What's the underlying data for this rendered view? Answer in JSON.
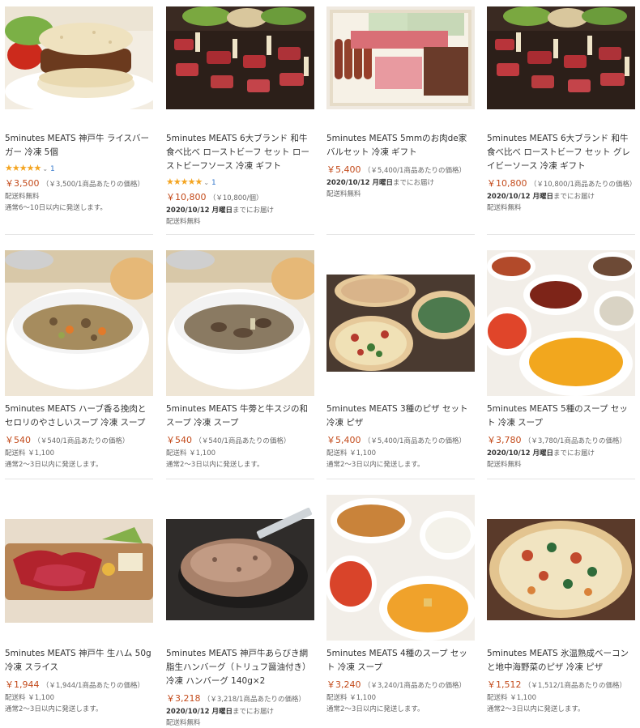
{
  "products": [
    {
      "title": "5minutes MEATS 神戸牛 ライスバーガー 冷凍 5個",
      "rating_stars": "★★★★★",
      "review_count": "1",
      "price": "￥3,500",
      "unit_price": "（￥3,500/1商品あたりの価格）",
      "shipping": "配送料無料",
      "ship_note": "通常6〜10日以内に発送します。",
      "image": "rice-burger"
    },
    {
      "title": "5minutes MEATS 6大ブランド 和牛食べ比べ ローストビーフ セット ローストビーフソース 冷凍 ギフト",
      "rating_stars": "★★★★★",
      "review_count": "1",
      "price": "￥10,800",
      "unit_price": "（￥10,800/個）",
      "delivery_date": "2020/10/12 月曜日",
      "delivery_suffix": "までにお届け",
      "shipping": "配送料無料",
      "image": "roast-beef"
    },
    {
      "title": "5minutes MEATS 5mmのお肉de家バルセット 冷凍 ギフト",
      "price": "￥5,400",
      "unit_price": "（￥5,400/1商品あたりの価格）",
      "delivery_date": "2020/10/12 月曜日",
      "delivery_suffix": "までにお届け",
      "shipping": "配送料無料",
      "image": "bar-set"
    },
    {
      "title": "5minutes MEATS 6大ブランド 和牛食べ比べ ローストビーフ セット グレイビーソース 冷凍 ギフト",
      "price": "￥10,800",
      "unit_price": "（￥10,800/1商品あたりの価格）",
      "delivery_date": "2020/10/12 月曜日",
      "delivery_suffix": "までにお届け",
      "shipping": "配送料無料",
      "image": "roast-beef"
    },
    {
      "title": "5minutes MEATS ハーブ香る挽肉とセロリのやさしいスープ 冷凍 スープ",
      "price": "￥540",
      "unit_price": "（￥540/1商品あたりの価格）",
      "shipping": "配送料 ￥1,100",
      "ship_note": "通常2〜3日以内に発送します。",
      "image": "soup-minced"
    },
    {
      "title": "5minutes MEATS 牛蒡と牛スジの和スープ 冷凍 スープ",
      "price": "￥540",
      "unit_price": "（￥540/1商品あたりの価格）",
      "shipping": "配送料 ￥1,100",
      "ship_note": "通常2〜3日以内に発送します。",
      "image": "soup-beef"
    },
    {
      "title": "5minutes MEATS 3種のピザ セット 冷凍 ピザ",
      "price": "￥5,400",
      "unit_price": "（￥5,400/1商品あたりの価格）",
      "shipping": "配送料 ￥1,100",
      "ship_note": "通常2〜3日以内に発送します。",
      "image": "pizza-set"
    },
    {
      "title": "5minutes MEATS 5種のスープ セット 冷凍 スープ",
      "price": "￥3,780",
      "unit_price": "（￥3,780/1商品あたりの価格）",
      "delivery_date": "2020/10/12 月曜日",
      "delivery_suffix": "までにお届け",
      "shipping": "配送料無料",
      "image": "soup-five"
    },
    {
      "title": "5minutes MEATS 神戸牛 生ハム 50g 冷凍 スライス",
      "price": "￥1,944",
      "unit_price": "（￥1,944/1商品あたりの価格）",
      "shipping": "配送料 ￥1,100",
      "ship_note": "通常2〜3日以内に発送します。",
      "image": "raw-ham"
    },
    {
      "title": "5minutes MEATS 神戸牛あらびき網脂生ハンバーグ（トリュフ醤油付き）冷凍 ハンバーグ 140g×2",
      "price": "￥3,218",
      "unit_price": "（￥3,218/1商品あたりの価格）",
      "delivery_date": "2020/10/12 月曜日",
      "delivery_suffix": "までにお届け",
      "shipping": "配送料無料",
      "image": "hamburg"
    },
    {
      "title": "5minutes MEATS 4種のスープ セット 冷凍 スープ",
      "price": "￥3,240",
      "unit_price": "（￥3,240/1商品あたりの価格）",
      "shipping": "配送料 ￥1,100",
      "ship_note": "通常2〜3日以内に発送します。",
      "image": "soup-four"
    },
    {
      "title": "5minutes MEATS 氷温熟成ベーコンと地中海野菜のピザ 冷凍 ピザ",
      "price": "￥1,512",
      "unit_price": "（￥1,512/1商品あたりの価格）",
      "shipping": "配送料 ￥1,100",
      "ship_note": "通常2〜3日以内に発送します。",
      "image": "bacon-pizza"
    }
  ],
  "colors": {
    "price": "#c34a1a",
    "stars": "#f4a522",
    "review_link": "#3377cc"
  }
}
